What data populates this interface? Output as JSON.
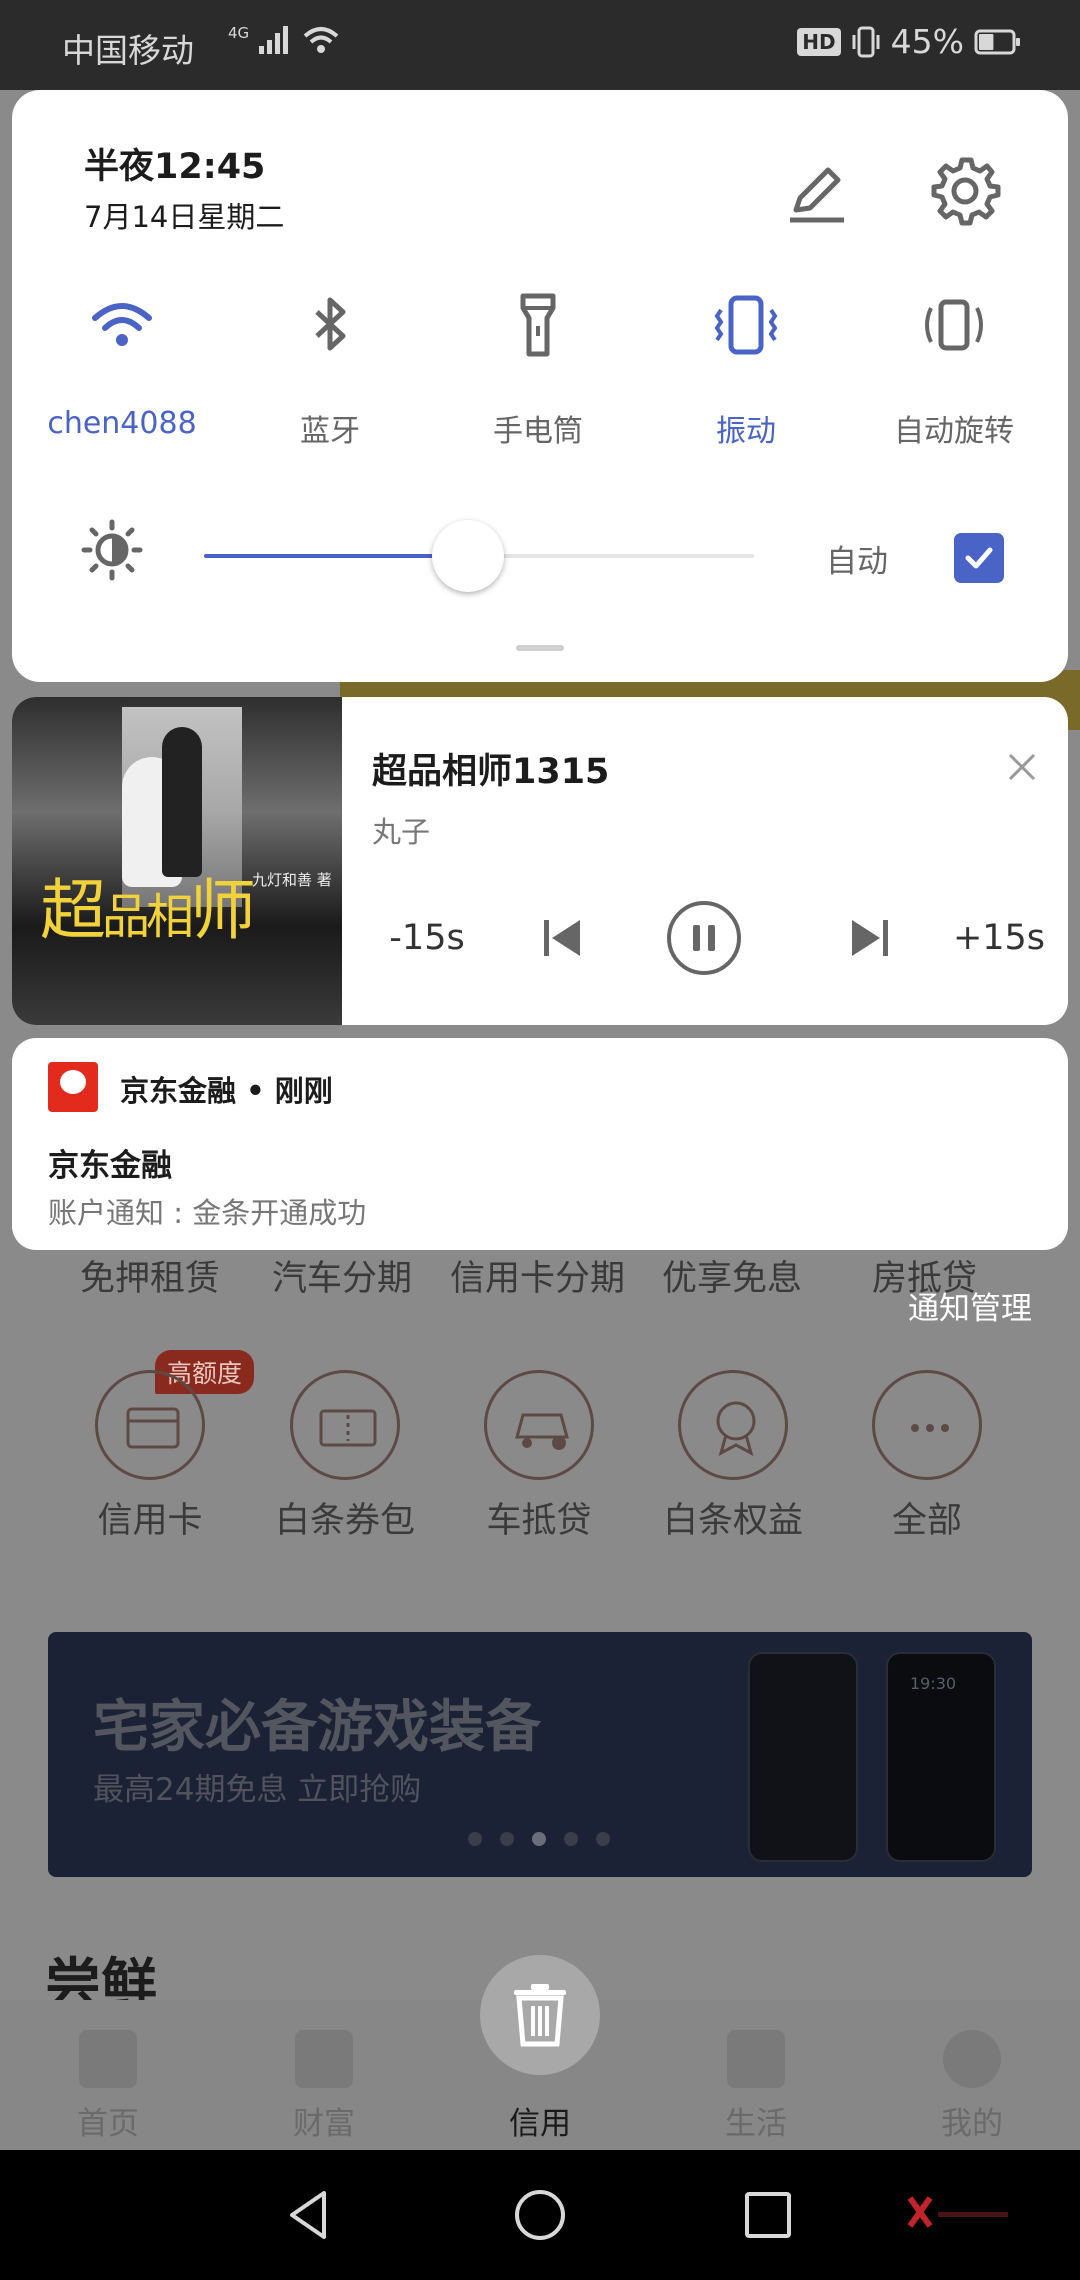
{
  "status_bar": {
    "carrier": "中国移动",
    "network": "4G",
    "hd": "HD",
    "battery_percent": "45%",
    "battery_level": 0.45
  },
  "quick_settings": {
    "time": "半夜12:45",
    "date": "7月14日星期二",
    "toggles": [
      {
        "label": "chen4088",
        "icon": "wifi-icon",
        "active": true
      },
      {
        "label": "蓝牙",
        "icon": "bluetooth-icon",
        "active": false
      },
      {
        "label": "手电筒",
        "icon": "flashlight-icon",
        "active": false
      },
      {
        "label": "振动",
        "icon": "vibrate-icon",
        "active": true
      },
      {
        "label": "自动旋转",
        "icon": "auto-rotate-icon",
        "active": false
      }
    ],
    "brightness_level": 0.48,
    "auto_label": "自动",
    "auto_checked": true,
    "accent_color": "#4a63c6"
  },
  "media": {
    "title": "超品相师1315",
    "artist": "丸子",
    "rewind_label": "-15s",
    "forward_label": "+15s",
    "art": {
      "title_big": "超",
      "title_small": "品相",
      "title_end": "师",
      "author": "九灯和善 著"
    }
  },
  "jd_notification": {
    "app_line": "京东金融 • 刚刚",
    "title": "京东金融",
    "body": "账户通知 : 金条开通成功"
  },
  "background_app": {
    "notification_manage": "通知管理",
    "row1": [
      "免押租赁",
      "汽车分期",
      "信用卡分期",
      "优享免息",
      "房抵贷"
    ],
    "badge": "高额度",
    "icons": [
      {
        "label": "信用卡",
        "icon": "credit-card-icon"
      },
      {
        "label": "白条券包",
        "icon": "coupon-icon"
      },
      {
        "label": "车抵贷",
        "icon": "car-loan-icon"
      },
      {
        "label": "白条权益",
        "icon": "award-icon"
      },
      {
        "label": "全部",
        "icon": "more-icon"
      }
    ],
    "banner": {
      "title": "宅家必备游戏装备",
      "subtitle": "最高24期免息 立即抢购",
      "phone_time": "19:30"
    },
    "section_title": "尝鲜",
    "tabs": [
      {
        "label": "首页",
        "icon": "home-icon"
      },
      {
        "label": "财富",
        "icon": "wallet-icon"
      },
      {
        "label": "信用",
        "icon": "credit-icon",
        "active": true
      },
      {
        "label": "生活",
        "icon": "bag-icon"
      },
      {
        "label": "我的",
        "icon": "profile-icon"
      }
    ]
  }
}
